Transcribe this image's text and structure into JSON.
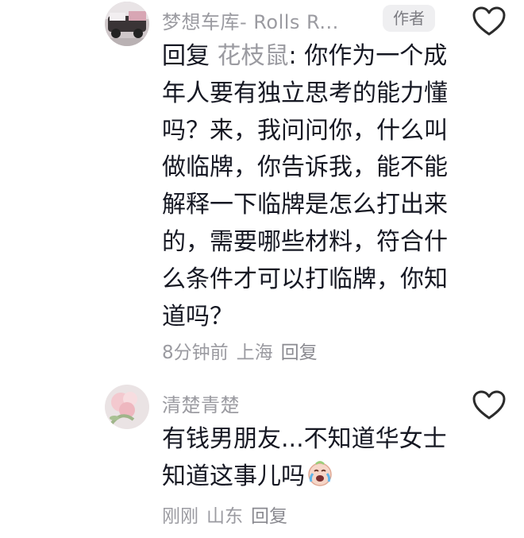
{
  "comments": [
    {
      "username": "梦想车库- Rolls R...",
      "author_badge": "作者",
      "reply_prefix": "回复",
      "reply_target": "花枝鼠",
      "reply_colon": ": ",
      "text": "你作为一个成年人要有独立思考的能力懂吗？来，我问问你，什么叫做临牌，你告诉我，能不能解释一下临牌是怎么打出来的，需要哪些材料，符合什么条件才可以打临牌，你知道吗？",
      "time": "8分钟前",
      "location": "上海",
      "reply_label": "回复"
    },
    {
      "username": "清楚青楚",
      "text": "有钱男朋友...不知道华女士知道这事儿吗",
      "emoji": "crying-laughing-face-icon",
      "time": "刚刚",
      "location": "山东",
      "reply_label": "回复"
    }
  ],
  "colors": {
    "text_primary": "#161823",
    "text_secondary": "#9b9ba1",
    "badge_bg": "#efeff1"
  }
}
